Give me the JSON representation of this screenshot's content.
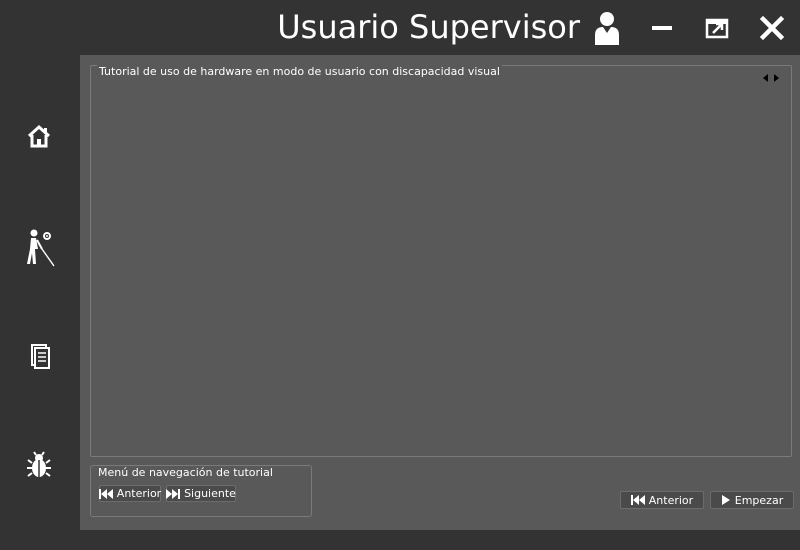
{
  "window": {
    "title": "Usuario Supervisor",
    "icons": {
      "user": "user-icon",
      "minimize": "minimize-icon",
      "restore": "restore-icon",
      "close": "close-icon"
    }
  },
  "sidebar": {
    "items": [
      {
        "icon": "home-icon"
      },
      {
        "icon": "blind-user-settings-icon"
      },
      {
        "icon": "documents-icon"
      },
      {
        "icon": "bug-icon"
      }
    ]
  },
  "tutorial": {
    "group_title": "Tutorial de uso de hardware en modo de usuario con discapacidad visual"
  },
  "nav_menu": {
    "group_title": "Menú de navegación de tutorial",
    "prev_label": "Anterior",
    "next_label": "Siguiente"
  },
  "footer": {
    "prev_label": "Anterior",
    "start_label": "Empezar"
  },
  "colors": {
    "background": "#333333",
    "panel": "#595959",
    "text": "#ffffff"
  }
}
